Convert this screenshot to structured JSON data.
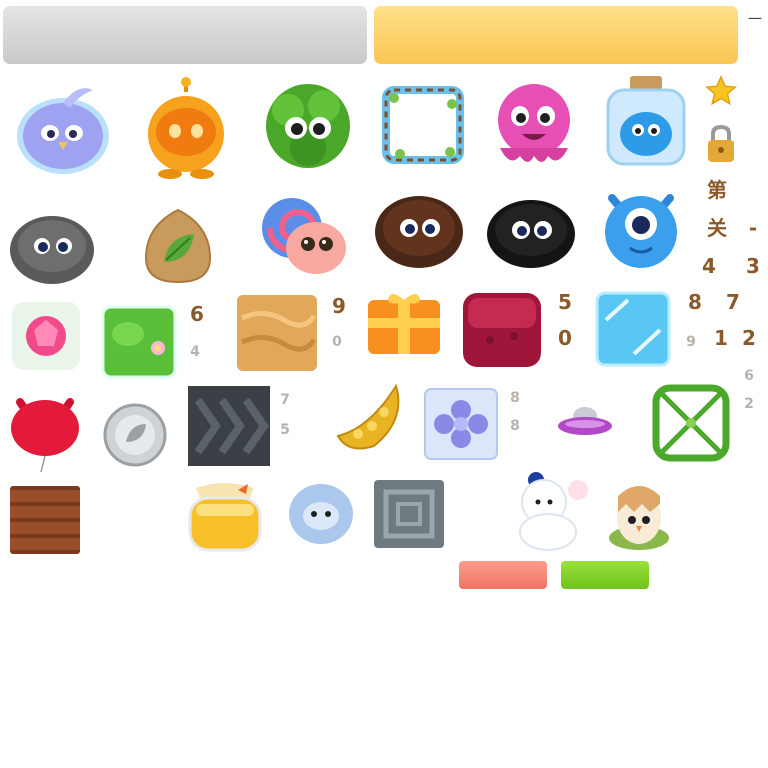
{
  "glyphs": {
    "dash_top": "一",
    "char_di": "第",
    "char_guan": "关",
    "dash": "-",
    "n_4a": "4",
    "n_3a": "3",
    "n_6": "6",
    "n_4b": "4",
    "n_9": "9",
    "n_0a": "0",
    "n_5a": "5",
    "n_0b": "0",
    "n_8a": "8",
    "n_7a": "7",
    "n_9b": "9",
    "n_1": "1",
    "n_2a": "2",
    "n_6b": "6",
    "n_2b": "2",
    "n_7b": "7",
    "n_5b": "5",
    "n_8b": "8",
    "n_8c": "8"
  },
  "colors": {
    "panel_gray": "#d2d2d2",
    "panel_gold": "#fbd06a",
    "button_red": "#f2806f",
    "button_green": "#7fd02a",
    "digit_brown": "#8a5a2a"
  },
  "sprites": [
    "bird-icon",
    "orange-robot-icon",
    "green-bush-icon",
    "vine-frame-icon",
    "pink-octopus-icon",
    "bird-jar-icon",
    "star-icon",
    "lock-icon",
    "gray-fuzzball-icon",
    "leaf-stone-icon",
    "snail-icon",
    "brown-fuzzball-icon",
    "black-fuzzball-icon",
    "blue-cyclops-icon",
    "pink-gem-icon",
    "lily-pad-tile-icon",
    "sand-tile-icon",
    "gift-box-icon",
    "jelly-block-icon",
    "ice-block-icon",
    "red-balloon-icon",
    "silver-coin-icon",
    "chevron-conveyor-icon",
    "yellow-pod-icon",
    "purple-flower-tile-icon",
    "ufo-icon",
    "vine-net-icon",
    "wooden-crate-icon",
    "honey-jar-icon",
    "yeti-icon",
    "stone-tile-icon",
    "polar-bear-icon",
    "chick-egg-icon"
  ]
}
